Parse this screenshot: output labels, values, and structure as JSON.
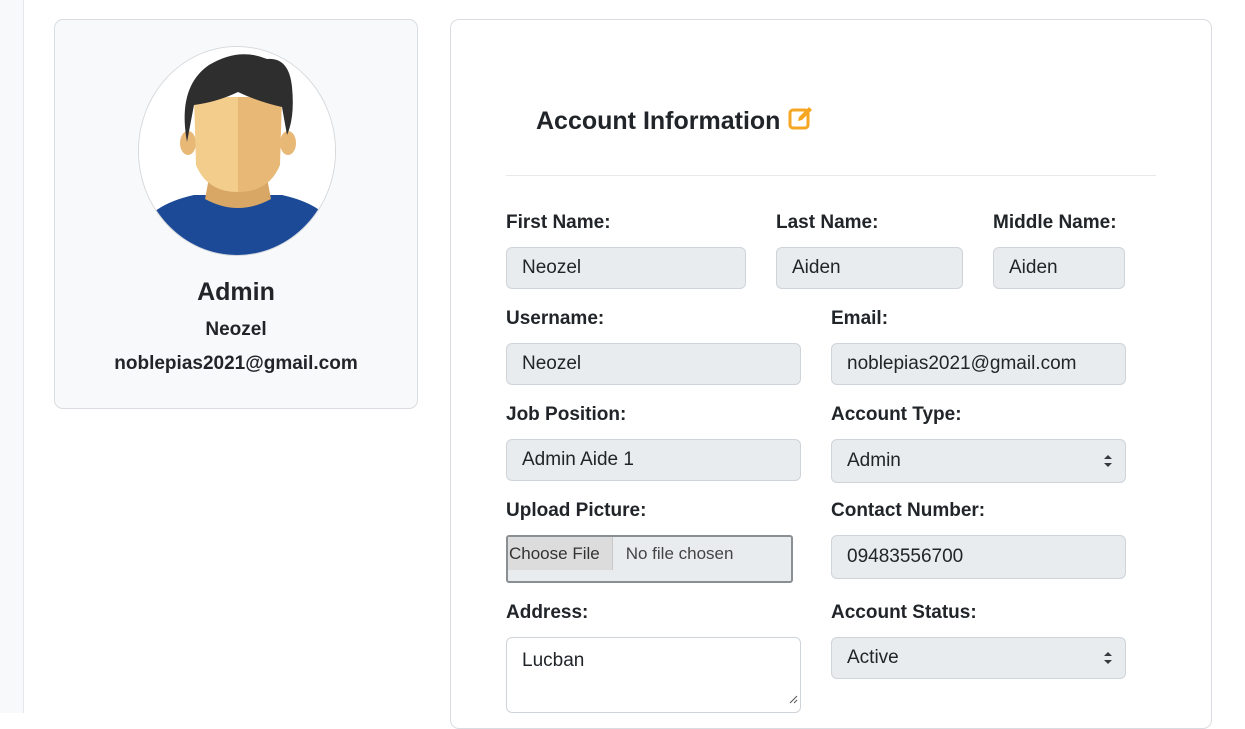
{
  "profile": {
    "role": "Admin",
    "username": "Neozel",
    "email": "noblepias2021@gmail.com"
  },
  "account_form": {
    "title": "Account Information",
    "fields": {
      "first_name": {
        "label": "First Name:",
        "value": "Neozel"
      },
      "last_name": {
        "label": "Last Name:",
        "value": "Aiden"
      },
      "middle_name": {
        "label": "Middle Name:",
        "value": "Aiden"
      },
      "username": {
        "label": "Username:",
        "value": "Neozel"
      },
      "email": {
        "label": "Email:",
        "value": "noblepias2021@gmail.com"
      },
      "job_position": {
        "label": "Job Position:",
        "value": "Admin Aide 1"
      },
      "account_type": {
        "label": "Account Type:",
        "value": "Admin"
      },
      "upload_picture": {
        "label": "Upload Picture:",
        "button": "Choose File",
        "status": "No file chosen"
      },
      "contact_number": {
        "label": "Contact Number:",
        "value": "09483556700"
      },
      "address": {
        "label": "Address:",
        "value": "Lucban"
      },
      "account_status": {
        "label": "Account Status:",
        "value": "Active"
      }
    }
  },
  "colors": {
    "edit_icon": "#f5a623",
    "field_bg": "#e9ecef",
    "card_bg": "#f8f9fa",
    "avatar_shirt": "#1c4a97",
    "avatar_hair": "#2e2e2e",
    "avatar_skin": "#f3cd8c"
  },
  "icons": {
    "edit": "edit-icon",
    "avatar": "user-avatar",
    "select": "select-arrows-icon"
  }
}
